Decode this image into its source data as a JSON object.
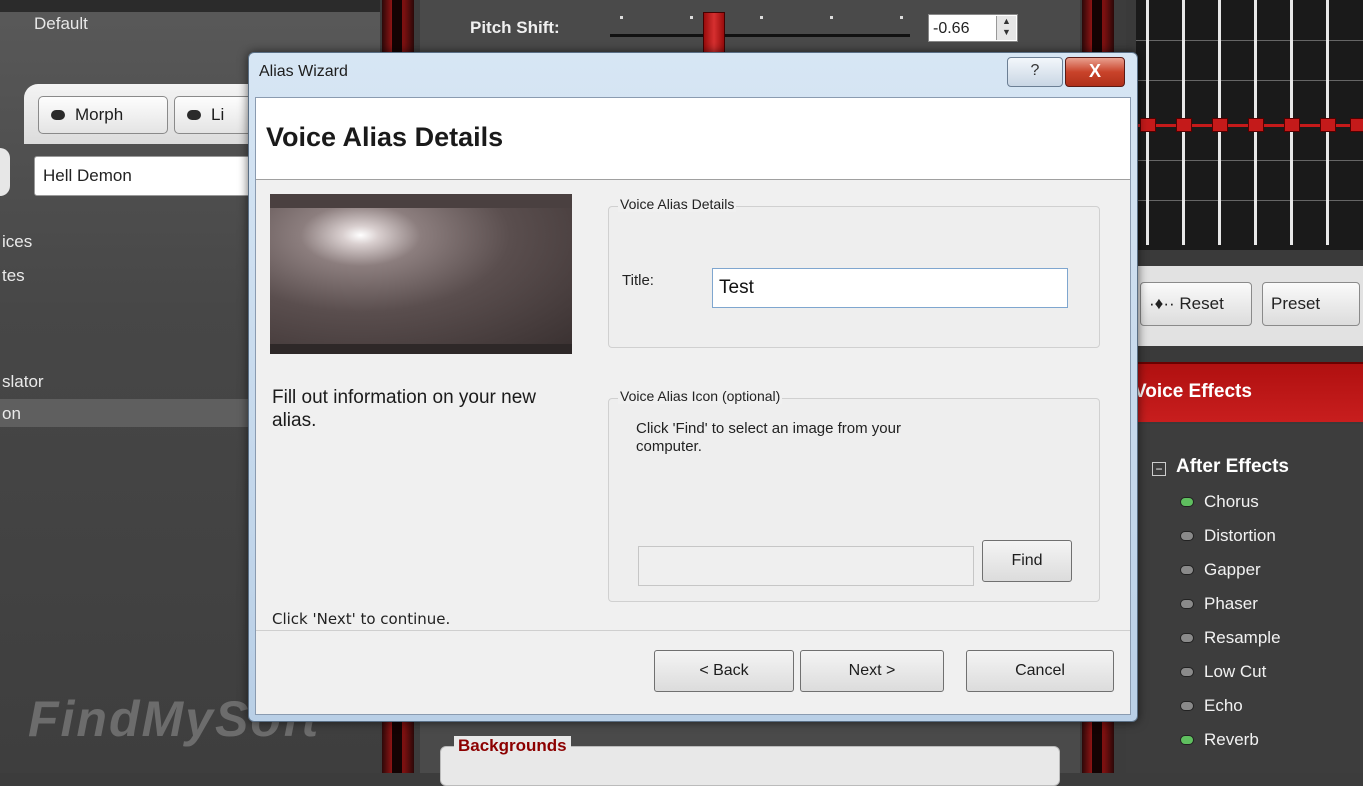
{
  "left_panel": {
    "preset_label": "Default",
    "tab_morph": "Morph",
    "tab_li": "Li",
    "voice_select_value": "Hell Demon",
    "items": [
      "ices",
      "tes",
      "slator",
      "on"
    ],
    "watermark": "FindMySoft"
  },
  "middle": {
    "pitch_label": "Pitch Shift:",
    "pitch_value": "-0.66",
    "backgrounds_label": "Backgrounds"
  },
  "right_panel": {
    "reset_label": "Reset",
    "preset_label": "Preset",
    "effects_title": "Voice Effects",
    "after_effects_label": "After Effects",
    "effects": [
      {
        "label": "Chorus",
        "on": true
      },
      {
        "label": "Distortion",
        "on": false
      },
      {
        "label": "Gapper",
        "on": false
      },
      {
        "label": "Phaser",
        "on": false
      },
      {
        "label": "Resample",
        "on": false
      },
      {
        "label": "Low Cut",
        "on": false
      },
      {
        "label": "Echo",
        "on": false
      },
      {
        "label": "Reverb",
        "on": true
      }
    ],
    "accent_color": "#c41a1a"
  },
  "dialog": {
    "window_title": "Alias Wizard",
    "help_label": "?",
    "close_label": "X",
    "heading": "Voice Alias Details",
    "fill_text": "Fill out information on your new alias.",
    "continue_text": "Click 'Next' to continue.",
    "details_group_label": "Voice Alias Details",
    "title_label": "Title:",
    "title_value": "Test",
    "icon_group_label": "Voice Alias Icon (optional)",
    "icon_hint": "Click 'Find' to select an image from your computer.",
    "icon_path_value": "",
    "find_label": "Find",
    "back_label": "< Back",
    "next_label": "Next >",
    "cancel_label": "Cancel"
  }
}
